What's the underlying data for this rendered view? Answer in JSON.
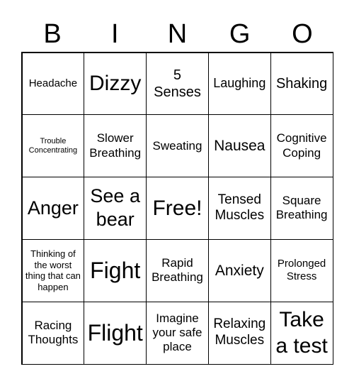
{
  "header": [
    "B",
    "I",
    "N",
    "G",
    "O"
  ],
  "cells": [
    {
      "text": "Headache",
      "size": 15
    },
    {
      "text": "Dizzy",
      "size": 30
    },
    {
      "text": "5 Senses",
      "size": 20
    },
    {
      "text": "Laughing",
      "size": 18
    },
    {
      "text": "Shaking",
      "size": 20
    },
    {
      "text": "Trouble Concentrating",
      "size": 11
    },
    {
      "text": "Slower Breathing",
      "size": 17
    },
    {
      "text": "Sweating",
      "size": 17
    },
    {
      "text": "Nausea",
      "size": 21
    },
    {
      "text": "Cognitive Coping",
      "size": 17
    },
    {
      "text": "Anger",
      "size": 27
    },
    {
      "text": "See a bear",
      "size": 27
    },
    {
      "text": "Free!",
      "size": 30
    },
    {
      "text": "Tensed Muscles",
      "size": 19
    },
    {
      "text": "Square Breathing",
      "size": 17
    },
    {
      "text": "Thinking of the worst thing that can happen",
      "size": 13
    },
    {
      "text": "Fight",
      "size": 32
    },
    {
      "text": "Rapid Breathing",
      "size": 17
    },
    {
      "text": "Anxiety",
      "size": 21
    },
    {
      "text": "Prolonged Stress",
      "size": 15
    },
    {
      "text": "Racing Thoughts",
      "size": 17
    },
    {
      "text": "Flight",
      "size": 32
    },
    {
      "text": "Imagine your safe place",
      "size": 17
    },
    {
      "text": "Relaxing Muscles",
      "size": 19
    },
    {
      "text": "Take a test",
      "size": 30
    }
  ]
}
